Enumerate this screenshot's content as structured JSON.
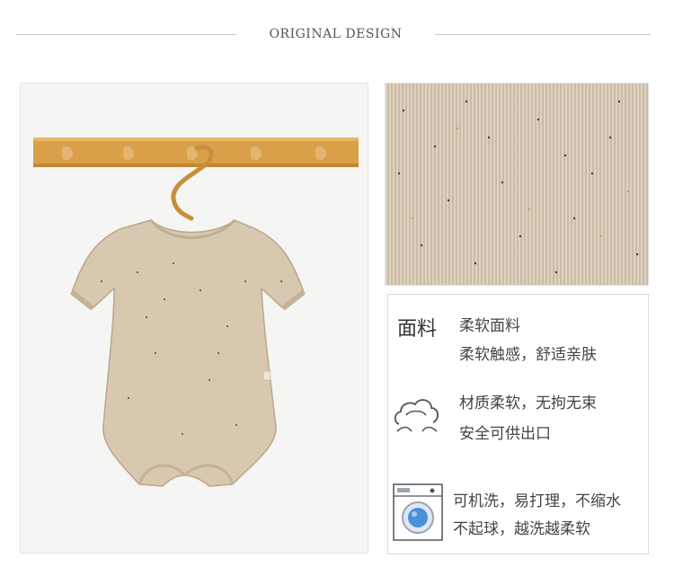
{
  "header": {
    "title": "ORIGINAL DESIGN"
  },
  "features": {
    "fabric_heading": "面料",
    "fabric_line1": "柔软面料",
    "fabric_line2": "柔软触感，舒适亲肤",
    "cloud_line1": "材质柔软，无拘无束",
    "cloud_line2": "安全可供出口",
    "wash_line1": "可机洗，易打理，不缩水",
    "wash_line2": "不起球，越洗越柔软"
  },
  "colors": {
    "fabric": "#d7c8b3",
    "rack": "#d9a04a",
    "wash_drum": "#4a90d9"
  },
  "icons": {
    "cloud": "soft-cloud-icon",
    "washer": "washing-machine-icon"
  }
}
